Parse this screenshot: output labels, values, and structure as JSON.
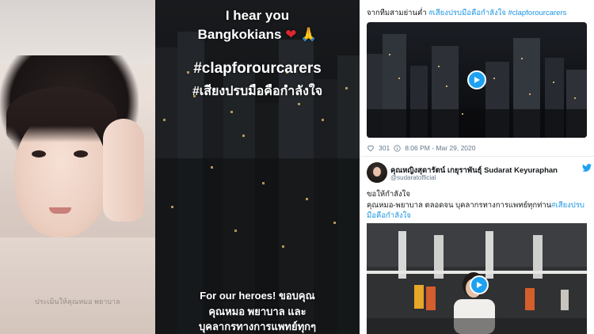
{
  "panel_selfie": {
    "caption": "ประเมินให้คุณหมอ พยาบาล"
  },
  "panel_story": {
    "line1": "I hear you",
    "line2_text": "Bangkokians",
    "heart_emoji": "❤",
    "pray_emoji": "🙏",
    "hashtag_en": "#clapforourcarers",
    "hashtag_th": "#เสียงปรบมือคือกำลังใจ",
    "footer_line1": "For our heroes! ขอบคุณ",
    "footer_line2": "คุณหมอ พยาบาล และ",
    "footer_line3": "บุคลากรทางการแพทย์ทุกๆ"
  },
  "tweet1": {
    "text_prefix": "จากทีมสามย่านค่ำ",
    "hashtag1": "#เสียงปรบมือคือกำลังใจ",
    "hashtag2": "#clapforourcarers",
    "like_count": "301",
    "timestamp": "8:06 PM - Mar 29, 2020",
    "play_icon": "play-icon"
  },
  "tweet2": {
    "display_name": "คุณหญิงสุดารัตน์ เกยุราพันธุ์ Sudarat Keyuraphan",
    "handle": "@sudaratofficial",
    "body_line1": "ขอให้กำลังใจ",
    "body_line2": "คุณหมอ-พยาบาล ตลอดจน บุคลากรทางการแพทย์ทุกท่าน",
    "body_hashtag_part1": "#เสียงปรบ",
    "body_hashtag_part2": "มือคือกำลังใจ",
    "brand_icon": "twitter-bird-icon"
  },
  "colors": {
    "hashtag": "#1b95e0",
    "twitter_blue": "#1da1f2",
    "heart": "#e0262e"
  }
}
